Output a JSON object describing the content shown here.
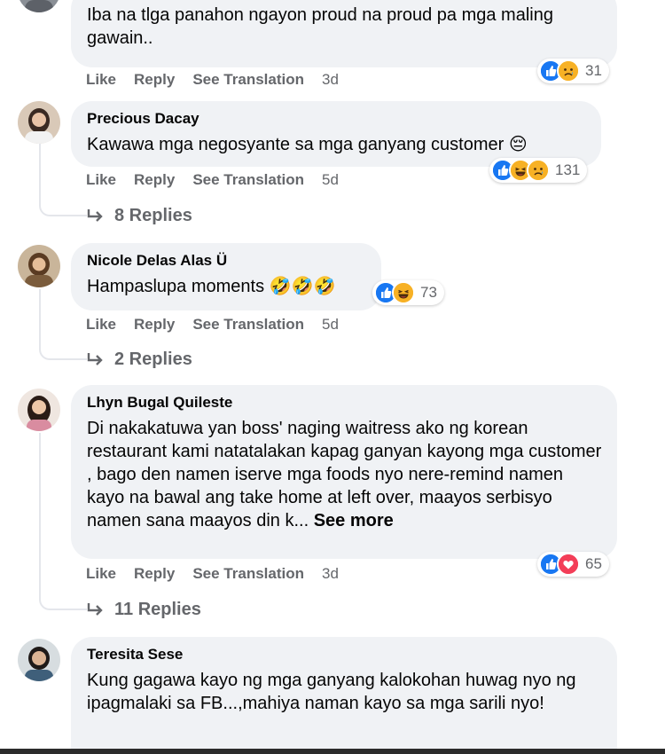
{
  "comments": [
    {
      "author": "",
      "text": "Iba na tlga panahon ngayon proud na proud pa mga maling gawain..",
      "reactions": [
        "like",
        "sad"
      ],
      "reaction_count": "31",
      "actions": {
        "like": "Like",
        "reply": "Reply",
        "translate": "See Translation",
        "time": "3d"
      }
    },
    {
      "author": "Precious Dacay",
      "text": "Kawawa mga negosyante sa mga ganyang customer 😔",
      "reactions": [
        "like",
        "haha",
        "sad"
      ],
      "reaction_count": "131",
      "actions": {
        "like": "Like",
        "reply": "Reply",
        "translate": "See Translation",
        "time": "5d"
      },
      "replies_label": "8 Replies"
    },
    {
      "author": "Nicole Delas Alas Ü",
      "text": "Hampaslupa moments 🤣🤣🤣",
      "reactions": [
        "like",
        "haha"
      ],
      "reaction_count": "73",
      "actions": {
        "like": "Like",
        "reply": "Reply",
        "translate": "See Translation",
        "time": "5d"
      },
      "replies_label": "2 Replies"
    },
    {
      "author": "Lhyn Bugal Quileste",
      "text": "Di nakakatuwa yan boss' naging waitress ako ng korean restaurant kami natatalakan kapag ganyan kayong mga customer , bago den namen iserve mga foods nyo nere-remind namen kayo na bawal ang take home at left over, maayos serbisyo namen sana maayos din k...",
      "see_more": "See more",
      "reactions": [
        "like",
        "love"
      ],
      "reaction_count": "65",
      "actions": {
        "like": "Like",
        "reply": "Reply",
        "translate": "See Translation",
        "time": "3d"
      },
      "replies_label": "11 Replies"
    },
    {
      "author": "Teresita Sese",
      "text": "Kung gagawa kayo ng mga ganyang kalokohan huwag nyo ng ipagmalaki sa FB...,mahiya naman kayo sa mga sarili nyo!"
    }
  ],
  "colors": {
    "bubble": "#f0f2f5",
    "meta_text": "#65676b",
    "like_blue": "#1877f2",
    "haha_yellow": "#f7b125",
    "love_red": "#f33e58"
  }
}
